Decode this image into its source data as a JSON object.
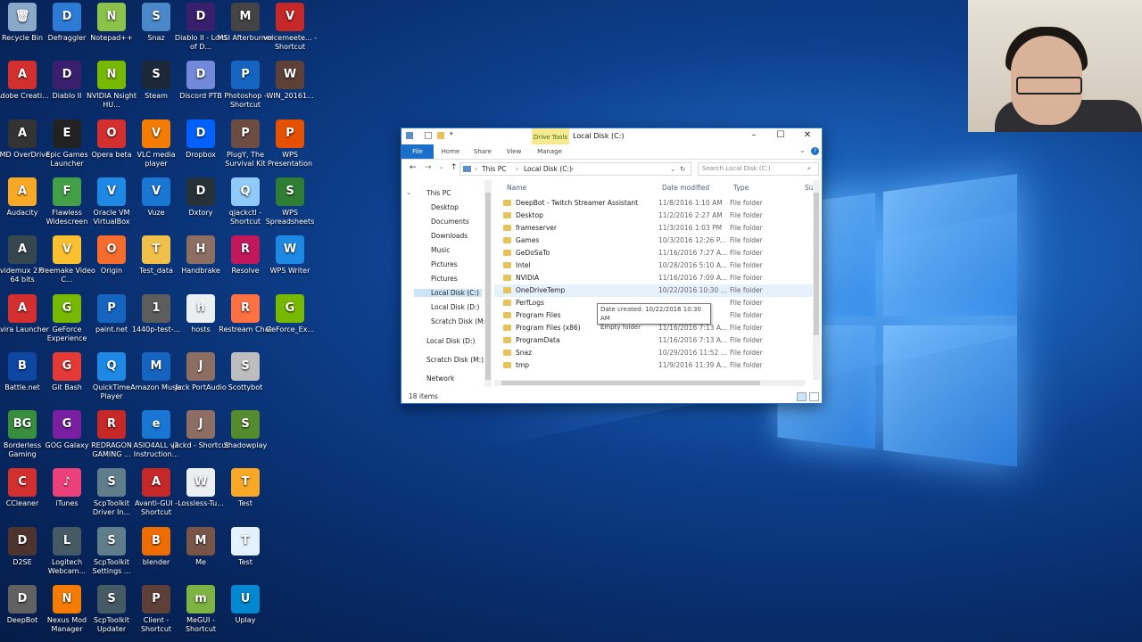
{
  "desktop": {
    "icons": [
      {
        "label": "Recycle Bin",
        "color": "#8aa8c8",
        "glyph": "🗑",
        "col": 0,
        "row": 0
      },
      {
        "label": "Defraggler",
        "color": "#2d7bd6",
        "glyph": "D",
        "col": 1,
        "row": 0
      },
      {
        "label": "Notepad++",
        "color": "#8bc34a",
        "glyph": "N",
        "col": 2,
        "row": 0
      },
      {
        "label": "Snaz",
        "color": "#4a88c7",
        "glyph": "S",
        "col": 3,
        "row": 0
      },
      {
        "label": "Diablo II - Lord of D...",
        "color": "#3a1f6e",
        "glyph": "D",
        "col": 4,
        "row": 0
      },
      {
        "label": "MSI Afterburner",
        "color": "#444",
        "glyph": "M",
        "col": 5,
        "row": 0
      },
      {
        "label": "voicemeete... - Shortcut",
        "color": "#c62828",
        "glyph": "V",
        "col": 6,
        "row": 0
      },
      {
        "label": "Adobe Creati...",
        "color": "#d32f2f",
        "glyph": "A",
        "col": 0,
        "row": 1
      },
      {
        "label": "Diablo II",
        "color": "#3a1f6e",
        "glyph": "D",
        "col": 1,
        "row": 1
      },
      {
        "label": "NVIDIA Nsight HU...",
        "color": "#76b900",
        "glyph": "N",
        "col": 2,
        "row": 1
      },
      {
        "label": "Steam",
        "color": "#1b2838",
        "glyph": "S",
        "col": 3,
        "row": 1
      },
      {
        "label": "Discord PTB",
        "color": "#7289da",
        "glyph": "D",
        "col": 4,
        "row": 1
      },
      {
        "label": "Photoshop - Shortcut",
        "color": "#1565c0",
        "glyph": "P",
        "col": 5,
        "row": 1
      },
      {
        "label": "WIN_20161...",
        "color": "#5d4037",
        "glyph": "W",
        "col": 6,
        "row": 1
      },
      {
        "label": "AMD OverDrive",
        "color": "#333",
        "glyph": "A",
        "col": 0,
        "row": 2
      },
      {
        "label": "Epic Games Launcher",
        "color": "#222",
        "glyph": "E",
        "col": 1,
        "row": 2
      },
      {
        "label": "Opera beta",
        "color": "#d32f2f",
        "glyph": "O",
        "col": 2,
        "row": 2
      },
      {
        "label": "VLC media player",
        "color": "#f57c00",
        "glyph": "V",
        "col": 3,
        "row": 2
      },
      {
        "label": "Dropbox",
        "color": "#0061fe",
        "glyph": "D",
        "col": 4,
        "row": 2
      },
      {
        "label": "PlugY, The Survival Kit",
        "color": "#6d4c41",
        "glyph": "P",
        "col": 5,
        "row": 2
      },
      {
        "label": "WPS Presentation",
        "color": "#e65100",
        "glyph": "P",
        "col": 6,
        "row": 2
      },
      {
        "label": "Audacity",
        "color": "#f9a825",
        "glyph": "A",
        "col": 0,
        "row": 3
      },
      {
        "label": "Flawless Widescreen",
        "color": "#43a047",
        "glyph": "F",
        "col": 1,
        "row": 3
      },
      {
        "label": "Oracle VM VirtualBox",
        "color": "#1e88e5",
        "glyph": "V",
        "col": 2,
        "row": 3
      },
      {
        "label": "Vuze",
        "color": "#1976d2",
        "glyph": "V",
        "col": 3,
        "row": 3
      },
      {
        "label": "Dxtory",
        "color": "#263238",
        "glyph": "D",
        "col": 4,
        "row": 3
      },
      {
        "label": "qjackctl - Shortcut",
        "color": "#90caf9",
        "glyph": "Q",
        "col": 5,
        "row": 3
      },
      {
        "label": "WPS Spreadsheets",
        "color": "#2e7d32",
        "glyph": "S",
        "col": 6,
        "row": 3
      },
      {
        "label": "Avidemux 2.6 - 64 bits",
        "color": "#37474f",
        "glyph": "A",
        "col": 0,
        "row": 4
      },
      {
        "label": "Freemake Video C...",
        "color": "#fbc02d",
        "glyph": "V",
        "col": 1,
        "row": 4
      },
      {
        "label": "Origin",
        "color": "#f56c2d",
        "glyph": "O",
        "col": 2,
        "row": 4
      },
      {
        "label": "Test_data",
        "color": "#f0c048",
        "glyph": "T",
        "col": 3,
        "row": 4
      },
      {
        "label": "Handbrake",
        "color": "#8d6e63",
        "glyph": "H",
        "col": 4,
        "row": 4
      },
      {
        "label": "Resolve",
        "color": "#c2185b",
        "glyph": "R",
        "col": 5,
        "row": 4
      },
      {
        "label": "WPS Writer",
        "color": "#1e88e5",
        "glyph": "W",
        "col": 6,
        "row": 4
      },
      {
        "label": "Avira Launcher",
        "color": "#d32f2f",
        "glyph": "A",
        "col": 0,
        "row": 5
      },
      {
        "label": "GeForce Experience",
        "color": "#76b900",
        "glyph": "G",
        "col": 1,
        "row": 5
      },
      {
        "label": "paint.net",
        "color": "#1565c0",
        "glyph": "P",
        "col": 2,
        "row": 5
      },
      {
        "label": "1440p-test-...",
        "color": "#5d5d5d",
        "glyph": "1",
        "col": 3,
        "row": 5
      },
      {
        "label": "hosts",
        "color": "#eceff1",
        "glyph": "h",
        "col": 4,
        "row": 5
      },
      {
        "label": "Restream Chat",
        "color": "#ff7043",
        "glyph": "R",
        "col": 5,
        "row": 5
      },
      {
        "label": "GeForce_Ex...",
        "color": "#76b900",
        "glyph": "G",
        "col": 6,
        "row": 5
      },
      {
        "label": "Battle.net",
        "color": "#0d47a1",
        "glyph": "B",
        "col": 0,
        "row": 6
      },
      {
        "label": "Git Bash",
        "color": "#e53935",
        "glyph": "G",
        "col": 1,
        "row": 6
      },
      {
        "label": "QuickTime Player",
        "color": "#1e88e5",
        "glyph": "Q",
        "col": 2,
        "row": 6
      },
      {
        "label": "Amazon Music",
        "color": "#1565c0",
        "glyph": "M",
        "col": 3,
        "row": 6
      },
      {
        "label": "Jack PortAudio",
        "color": "#8d6e63",
        "glyph": "J",
        "col": 4,
        "row": 6
      },
      {
        "label": "Scottybot",
        "color": "#bdbdbd",
        "glyph": "S",
        "col": 5,
        "row": 6
      },
      {
        "label": "Borderless Gaming",
        "color": "#388e3c",
        "glyph": "BG",
        "col": 0,
        "row": 7
      },
      {
        "label": "GOG Galaxy",
        "color": "#7b1fa2",
        "glyph": "G",
        "col": 1,
        "row": 7
      },
      {
        "label": "REDRAGON GAMING ...",
        "color": "#c62828",
        "glyph": "R",
        "col": 2,
        "row": 7
      },
      {
        "label": "ASIO4ALL v2 Instruction...",
        "color": "#1976d2",
        "glyph": "e",
        "col": 3,
        "row": 7
      },
      {
        "label": "jackd - Shortcut",
        "color": "#8d6e63",
        "glyph": "J",
        "col": 4,
        "row": 7
      },
      {
        "label": "Shadowplay",
        "color": "#558b2f",
        "glyph": "S",
        "col": 5,
        "row": 7
      },
      {
        "label": "CCleaner",
        "color": "#d32f2f",
        "glyph": "C",
        "col": 0,
        "row": 8
      },
      {
        "label": "iTunes",
        "color": "#ec407a",
        "glyph": "♪",
        "col": 1,
        "row": 8
      },
      {
        "label": "ScpToolkit Driver In...",
        "color": "#607d8b",
        "glyph": "S",
        "col": 2,
        "row": 8
      },
      {
        "label": "Avanti-GUI - Shortcut",
        "color": "#c62828",
        "glyph": "A",
        "col": 3,
        "row": 8
      },
      {
        "label": "Lossless-Tu...",
        "color": "#eceff1",
        "glyph": "W",
        "col": 4,
        "row": 8
      },
      {
        "label": "Test",
        "color": "#f9a825",
        "glyph": "T",
        "col": 5,
        "row": 8
      },
      {
        "label": "D2SE",
        "color": "#4e342e",
        "glyph": "D",
        "col": 0,
        "row": 9
      },
      {
        "label": "Logitech Webcam...",
        "color": "#455a64",
        "glyph": "L",
        "col": 1,
        "row": 9
      },
      {
        "label": "ScpToolkit Settings ...",
        "color": "#607d8b",
        "glyph": "S",
        "col": 2,
        "row": 9
      },
      {
        "label": "blender",
        "color": "#ef6c00",
        "glyph": "B",
        "col": 3,
        "row": 9
      },
      {
        "label": "Me",
        "color": "#795548",
        "glyph": "M",
        "col": 4,
        "row": 9
      },
      {
        "label": "Test",
        "color": "#e3f2fd",
        "glyph": "T",
        "col": 5,
        "row": 9
      },
      {
        "label": "DeepBot",
        "color": "#616161",
        "glyph": "D",
        "col": 0,
        "row": 10
      },
      {
        "label": "Nexus Mod Manager",
        "color": "#f57c00",
        "glyph": "N",
        "col": 1,
        "row": 10
      },
      {
        "label": "ScpToolkit Updater",
        "color": "#455a64",
        "glyph": "S",
        "col": 2,
        "row": 10
      },
      {
        "label": "Client - Shortcut",
        "color": "#5d4037",
        "glyph": "P",
        "col": 3,
        "row": 10
      },
      {
        "label": "MeGUI - Shortcut",
        "color": "#7cb342",
        "glyph": "m",
        "col": 4,
        "row": 10
      },
      {
        "label": "Uplay",
        "color": "#0288d1",
        "glyph": "U",
        "col": 5,
        "row": 10
      }
    ]
  },
  "explorer": {
    "title": "Local Disk (C:)",
    "drive_tools": "Drive Tools",
    "tabs": {
      "file": "File",
      "home": "Home",
      "share": "Share",
      "view": "View",
      "manage": "Manage"
    },
    "address": [
      "This PC",
      "Local Disk (C:)"
    ],
    "search_placeholder": "Search Local Disk (C:)",
    "nav": {
      "this_pc": "This PC",
      "desktop": "Desktop",
      "documents": "Documents",
      "downloads": "Downloads",
      "music": "Music",
      "pictures": "Pictures",
      "pictures2": "Pictures",
      "local_c": "Local Disk (C:)",
      "local_d": "Local Disk (D:)",
      "scratch": "Scratch Disk (M:)",
      "local_d2": "Local Disk (D:)",
      "scratch2": "Scratch Disk (M:)",
      "network": "Network"
    },
    "columns": {
      "name": "Name",
      "date": "Date modified",
      "type": "Type",
      "size": "Siz"
    },
    "files": [
      {
        "name": "DeepBot - Twitch Streamer Assistant",
        "date": "11/8/2016 1:10 AM",
        "type": "File folder"
      },
      {
        "name": "Desktop",
        "date": "11/2/2016 2:27 AM",
        "type": "File folder"
      },
      {
        "name": "frameserver",
        "date": "11/3/2016 1:03 PM",
        "type": "File folder"
      },
      {
        "name": "Games",
        "date": "10/3/2016 12:26 P...",
        "type": "File folder"
      },
      {
        "name": "GeDoSaTo",
        "date": "11/16/2016 7:27 A...",
        "type": "File folder"
      },
      {
        "name": "Intel",
        "date": "10/28/2016 5:10 A...",
        "type": "File folder"
      },
      {
        "name": "NVIDIA",
        "date": "11/16/2016 7:09 A...",
        "type": "File folder"
      },
      {
        "name": "OneDriveTemp",
        "date": "10/22/2016 10:30 ...",
        "type": "File folder"
      },
      {
        "name": "PerfLogs",
        "date": "",
        "type": "File folder"
      },
      {
        "name": "Program Files",
        "date": "",
        "type": "File folder"
      },
      {
        "name": "Program Files (x86)",
        "date": "11/16/2016 7:13 A...",
        "type": "File folder"
      },
      {
        "name": "ProgramData",
        "date": "11/16/2016 7:13 A...",
        "type": "File folder"
      },
      {
        "name": "Snaz",
        "date": "10/29/2016 11:52 ...",
        "type": "File folder"
      },
      {
        "name": "tmp",
        "date": "11/9/2016 11:39 A...",
        "type": "File folder"
      }
    ],
    "tooltip": {
      "line1": "Date created: 10/22/2016 10:30 AM",
      "line2": "Empty folder"
    },
    "status": "18 items"
  }
}
